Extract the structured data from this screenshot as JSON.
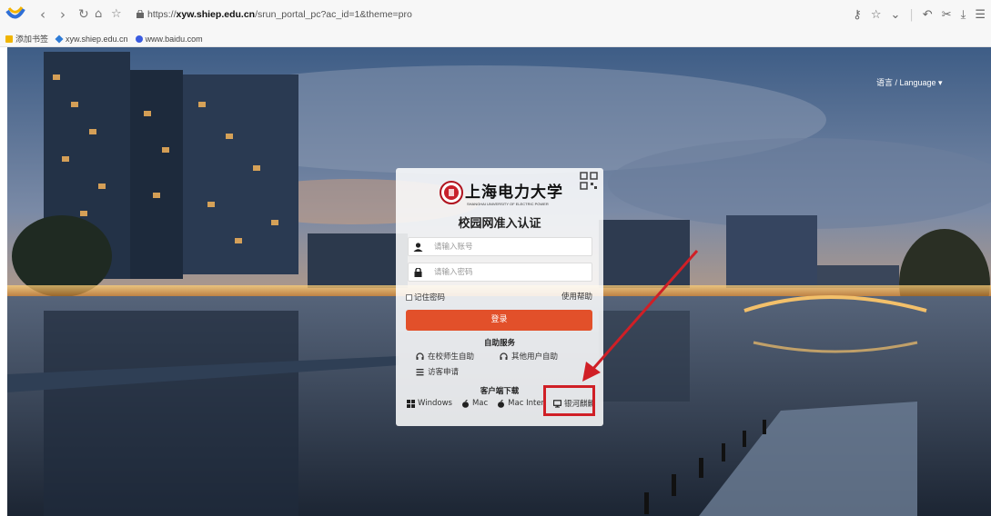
{
  "browser": {
    "url_prefix": "https://",
    "url_host": "xyw.shiep.edu.cn",
    "url_path": "/srun_portal_pc?ac_id=1&theme=pro",
    "bookmarks": [
      {
        "label": "添加书签"
      },
      {
        "label": "xyw.shiep.edu.cn"
      },
      {
        "label": "www.baidu.com"
      }
    ]
  },
  "page": {
    "language_label": "语言 / Language ▾"
  },
  "card": {
    "university_name": "上海电力大学",
    "university_name_en": "SHANGHAI UNIVERSITY OF ELECTRIC POWER",
    "title": "校园网准入认证",
    "username_placeholder": "请输入账号",
    "password_placeholder": "请输入密码",
    "remember_label": "记住密码",
    "help_label": "使用帮助",
    "login_label": "登录",
    "self_service_title": "自助服务",
    "self_service_items": [
      {
        "label": "在校师生自助"
      },
      {
        "label": "其他用户自助"
      },
      {
        "label": "访客申请"
      }
    ],
    "download_title": "客户端下载",
    "downloads": [
      {
        "label": "Windows"
      },
      {
        "label": "Mac"
      },
      {
        "label": "Mac Inter"
      },
      {
        "label": "银河麒麟"
      }
    ]
  },
  "colors": {
    "login_button": "#e2502a",
    "annotation": "#d01f26"
  }
}
